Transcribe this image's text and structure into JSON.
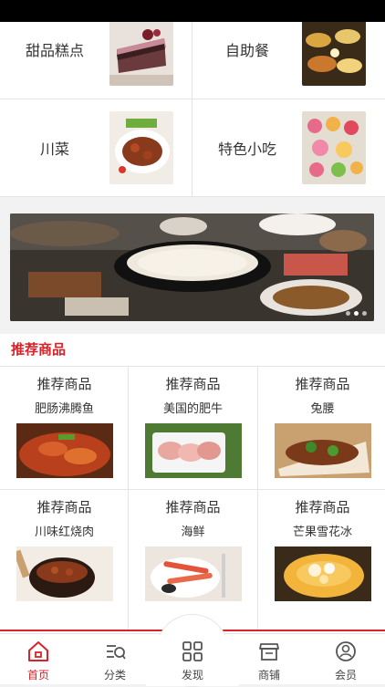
{
  "categories": [
    {
      "label": "甜品糕点",
      "image": "cake-photo"
    },
    {
      "label": "自助餐",
      "image": "buffet-photo"
    },
    {
      "label": "川菜",
      "image": "sichuan-dish-photo"
    },
    {
      "label": "特色小吃",
      "image": "snacks-photo"
    }
  ],
  "banner": {
    "image": "hotpot-banner-photo",
    "slides": 3,
    "active": 1
  },
  "recommend": {
    "title": "推荐商品",
    "items": [
      {
        "title": "推荐商品",
        "name": "肥肠沸腾鱼",
        "image": "boiling-fish-photo"
      },
      {
        "title": "推荐商品",
        "name": "美国的肥牛",
        "image": "beef-slices-photo"
      },
      {
        "title": "推荐商品",
        "name": "兔腰",
        "image": "rabbit-kidney-photo"
      },
      {
        "title": "推荐商品",
        "name": "川味红烧肉",
        "image": "braised-pork-photo"
      },
      {
        "title": "推荐商品",
        "name": "海鲜",
        "image": "seafood-photo"
      },
      {
        "title": "推荐商品",
        "name": "芒果雪花冰",
        "image": "mango-ice-photo"
      }
    ]
  },
  "tabs": [
    {
      "label": "首页",
      "icon": "home-icon",
      "active": true
    },
    {
      "label": "分类",
      "icon": "category-search-icon",
      "active": false
    },
    {
      "label": "发现",
      "icon": "grid-icon",
      "active": false
    },
    {
      "label": "商铺",
      "icon": "shop-icon",
      "active": false
    },
    {
      "label": "会员",
      "icon": "user-icon",
      "active": false
    }
  ],
  "colors": {
    "accent": "#d9232a",
    "text": "#333333"
  }
}
